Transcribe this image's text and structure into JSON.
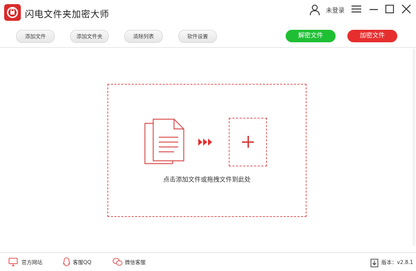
{
  "app": {
    "title": "闪电文件夹加密大师"
  },
  "user": {
    "status_label": "未登录"
  },
  "toolbar": {
    "add_file": "添加文件",
    "add_folder": "添加文件夹",
    "clear_list": "清除列表",
    "settings": "软件设置",
    "decrypt": "解密文件",
    "encrypt": "加密文件"
  },
  "dropzone": {
    "hint": "点击添加文件或拖拽文件到此处"
  },
  "footer": {
    "website": "官方网站",
    "qq_support": "客服QQ",
    "wechat_support": "微信客服",
    "version": "版本：v2.8.1"
  },
  "colors": {
    "brand_red": "#e62e2e",
    "decrypt_green": "#1fbf34",
    "accent_dash": "#e24a4a"
  }
}
